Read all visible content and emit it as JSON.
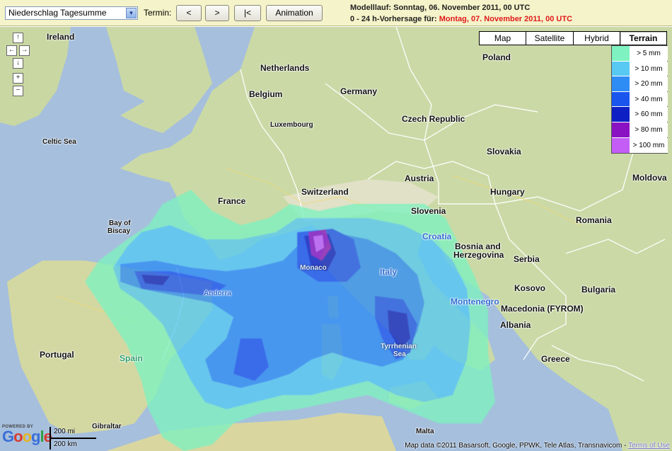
{
  "toolbar": {
    "product_select": "Niederschlag Tagesumme",
    "termin_label": "Termin:",
    "prev_label": "<",
    "next_label": ">",
    "first_label": "|<",
    "animation_label": "Animation",
    "model_run": "Modelllauf: Sonntag, 06. November 2011, 00 UTC",
    "forecast_prefix": "0 - 24 h-Vorhersage für:",
    "forecast_date": "Montag, 07. November 2011, 00 UTC",
    "forecast_color": "#e0191b"
  },
  "map_types": [
    "Map",
    "Satellite",
    "Hybrid",
    "Terrain"
  ],
  "map_type_active": "Terrain",
  "legend": [
    {
      "label": "> 5 mm",
      "color": "#7ef2c0"
    },
    {
      "label": "> 10 mm",
      "color": "#57c9f2"
    },
    {
      "label": "> 20 mm",
      "color": "#2e8cf5"
    },
    {
      "label": "> 40 mm",
      "color": "#1a55ee"
    },
    {
      "label": "> 60 mm",
      "color": "#0e20c4"
    },
    {
      "label": "> 80 mm",
      "color": "#8a12c2"
    },
    {
      "label": "> 100 mm",
      "color": "#c35df6"
    }
  ],
  "nav": {
    "up": "↑",
    "left": "←",
    "right": "→",
    "down": "↓",
    "zoom_in": "+",
    "zoom_out": "−"
  },
  "labels": {
    "ireland": "Ireland",
    "netherlands": "Netherlands",
    "germany": "Germany",
    "poland": "Poland",
    "belgium": "Belgium",
    "luxembourg": "Luxembourg",
    "czech": "Czech Republic",
    "slovakia": "Slovakia",
    "celtic": "Celtic Sea",
    "austria": "Austria",
    "hungary": "Hungary",
    "moldova": "Moldova",
    "switzerland": "Switzerland",
    "france": "France",
    "slovenia": "Slovenia",
    "romania": "Romania",
    "croatia": "Croatia",
    "bosnia1": "Bosnia and",
    "bosnia2": "Herzegovina",
    "serbia": "Serbia",
    "biscay1": "Bay of",
    "biscay2": "Biscay",
    "monaco": "Monaco",
    "italy": "Italy",
    "andorra": "Andorra",
    "kosovo": "Kosovo",
    "bulgaria": "Bulgaria",
    "montenegro": "Montenegro",
    "macedonia": "Macedonia (FYROM)",
    "albania": "Albania",
    "tyrr1": "Tyrrhenian",
    "tyrr2": "Sea",
    "portugal": "Portugal",
    "spain": "Spain",
    "greece": "Greece",
    "gibraltar": "Gibraltar",
    "malta": "Malta"
  },
  "google": {
    "powered_by": "POWERED BY",
    "logo": "Google"
  },
  "scale": {
    "miles": "200 mi",
    "km": "200 km"
  },
  "attribution": {
    "text": "Map data ©2011 Basarsoft, Google, PPWK, Tele Atlas, Transnavicom - ",
    "link": "Terms of Use"
  }
}
